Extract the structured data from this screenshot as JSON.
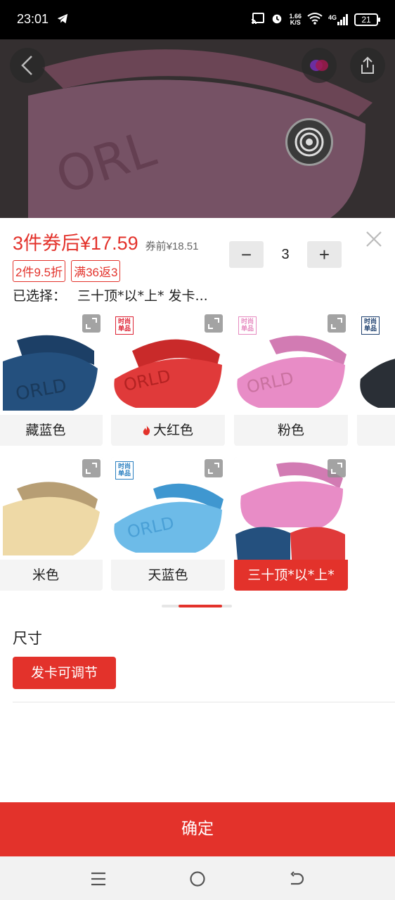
{
  "status_bar": {
    "time": "23:01",
    "net_speed_value": "1.66",
    "net_speed_unit": "K/S",
    "network": "4G",
    "battery": "21"
  },
  "product": {
    "price_label": "3件券后¥17.59",
    "price_before": "券前¥18.51",
    "quantity": "3",
    "minus": "−",
    "plus": "+",
    "promos": [
      "2件9.5折",
      "满36返3"
    ],
    "selected_label": "已选择：",
    "selected_value": "三十顶*以*上* 发卡..."
  },
  "variants": [
    {
      "label": "藏蓝色",
      "color": "#24507e"
    },
    {
      "label": "大红色",
      "color": "#e03a3a",
      "hot": true
    },
    {
      "label": "粉色",
      "color": "#e88cc6"
    },
    {
      "label": "米色",
      "color": "#eed9a6"
    },
    {
      "label": "天蓝色",
      "color": "#6dbbe8"
    },
    {
      "label": "三十顶*以*上*",
      "color": "#e88cc6",
      "selected": true
    }
  ],
  "badge_text": "时尚单品",
  "size": {
    "title": "尺寸",
    "option": "发卡可调节"
  },
  "confirm_label": "确定",
  "colors": {
    "accent": "#e3322b"
  }
}
